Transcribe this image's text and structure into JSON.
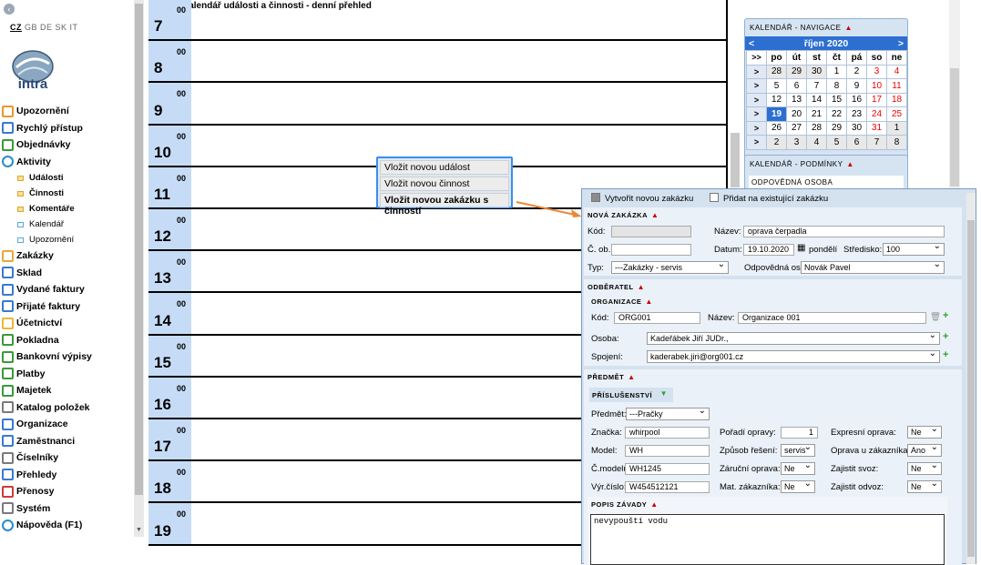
{
  "languages": {
    "active": "CZ",
    "others": "GB DE SK IT"
  },
  "logo_text": "intra",
  "nav": [
    {
      "label": "Upozornění",
      "icon": "bell-icon"
    },
    {
      "label": "Rychlý přístup",
      "icon": "grid-icon"
    },
    {
      "label": "Objednávky",
      "icon": "cart-icon"
    },
    {
      "label": "Aktivity",
      "icon": "refresh-icon"
    },
    {
      "label": "Události",
      "icon": "folder-icon",
      "sub": true
    },
    {
      "label": "Činnosti",
      "icon": "folder-icon",
      "sub": true
    },
    {
      "label": "Komentáře",
      "icon": "folder-icon",
      "sub": true
    },
    {
      "label": "Kalendář",
      "icon": "page-icon",
      "sub": true,
      "light": true
    },
    {
      "label": "Upozornění",
      "icon": "page-icon",
      "sub": true,
      "light": true
    },
    {
      "label": "Zakázky",
      "icon": "clipboard-icon"
    },
    {
      "label": "Sklad",
      "icon": "warehouse-icon"
    },
    {
      "label": "Vydané faktury",
      "icon": "invoice-out-icon"
    },
    {
      "label": "Přijaté faktury",
      "icon": "invoice-in-icon"
    },
    {
      "label": "Účetnictví",
      "icon": "ledger-icon"
    },
    {
      "label": "Pokladna",
      "icon": "cashbox-icon"
    },
    {
      "label": "Bankovní výpisy",
      "icon": "bank-icon"
    },
    {
      "label": "Platby",
      "icon": "coins-icon"
    },
    {
      "label": "Majetek",
      "icon": "building-icon"
    },
    {
      "label": "Katalog položek",
      "icon": "catalog-icon"
    },
    {
      "label": "Organizace",
      "icon": "organization-icon"
    },
    {
      "label": "Zaměstnanci",
      "icon": "employees-icon"
    },
    {
      "label": "Číselníky",
      "icon": "gear-icon"
    },
    {
      "label": "Přehledy",
      "icon": "list-icon"
    },
    {
      "label": "Přenosy",
      "icon": "transfer-icon"
    },
    {
      "label": "Systém",
      "icon": "wrench-icon"
    },
    {
      "label": "Nápověda (F1)",
      "icon": "help-icon"
    }
  ],
  "calendar_title": "Kalendář události a činnosti - denní přehled",
  "hours": [
    "7",
    "8",
    "9",
    "10",
    "11",
    "12",
    "13",
    "14",
    "15",
    "16",
    "17",
    "18",
    "19"
  ],
  "minutes": "00",
  "context_menu": [
    "Vložit novou událost",
    "Vložit novou činnost",
    "Vložit novou zakázku s činností"
  ],
  "calnav": {
    "title": "KALENDÁŘ - NAVIGACE",
    "prev": "<",
    "next": ">",
    "month": "říjen 2020",
    "week_jump": ">>",
    "weekdays": [
      "po",
      "út",
      "st",
      "čt",
      "pá",
      "so",
      "ne"
    ],
    "row_arrow": ">",
    "weeks": [
      [
        "28",
        "29",
        "30",
        "1",
        "2",
        "3",
        "4"
      ],
      [
        "5",
        "6",
        "7",
        "8",
        "9",
        "10",
        "11"
      ],
      [
        "12",
        "13",
        "14",
        "15",
        "16",
        "17",
        "18"
      ],
      [
        "19",
        "20",
        "21",
        "22",
        "23",
        "24",
        "25"
      ],
      [
        "26",
        "27",
        "28",
        "29",
        "30",
        "31",
        "1"
      ],
      [
        "2",
        "3",
        "4",
        "5",
        "6",
        "7",
        "8"
      ]
    ],
    "today": "19"
  },
  "conditions": {
    "title": "KALENDÁŘ - PODMÍNKY",
    "responsible": "ODPOVĚDNÁ OSOBA"
  },
  "form": {
    "create_new": "Vytvořit novou zakázku",
    "add_existing": "Přidat na existující zakázku",
    "section_new": "NOVÁ ZAKÁZKA",
    "kod_label": "Kód:",
    "kod_value": "",
    "nazev_label": "Název:",
    "nazev_value": "oprava čerpadla",
    "cob_label": "Č. ob.:",
    "cob_value": "",
    "datum_label": "Datum:",
    "datum_value": "19.10.2020",
    "day_name": "pondělí",
    "stredisko_label": "Středisko:",
    "stredisko_value": "100",
    "typ_label": "Typ:",
    "typ_value": "---Zakázky - servis",
    "odpovedna_label": "Odpovědná os.:",
    "odpovedna_value": "Novák Pavel",
    "section_odb": "ODBĚRATEL",
    "section_org": "ORGANIZACE",
    "org_kod_label": "Kód:",
    "org_kod_value": "ORG001",
    "org_nazev_label": "Název:",
    "org_nazev_value": "Organizace 001",
    "osoba_label": "Osoba:",
    "osoba_value": "Kadeřábek Jiří JUDr.,",
    "spojeni_label": "Spojení:",
    "spojeni_value": "kaderabek.jiri@org001.cz",
    "section_predmet": "PŘEDMĚT",
    "prislusenstvi": "PŘÍSLUŠENSTVÍ",
    "predmet_label": "Předmět:",
    "predmet_value": "---Pračky",
    "znacka_label": "Značka:",
    "znacka_value": "whirpool",
    "poradi_label": "Pořadí opravy:",
    "poradi_value": "1",
    "expresni_label": "Expresní oprava:",
    "expresni_value": "Ne",
    "model_label": "Model:",
    "model_value": "WH",
    "zpusob_label": "Způsob řešení:",
    "zpusob_value": "servis",
    "oprava_zak_label": "Oprava u zákazníka:",
    "oprava_zak_value": "Ano",
    "cmodelu_label": "Č.modelu:",
    "cmodelu_value": "WH1245",
    "zarucni_label": "Záruční oprava:",
    "zarucni_value": "Ne",
    "svoz_label": "Zajistit svoz:",
    "svoz_value": "Ne",
    "vyrcislo_label": "Výr.číslo:",
    "vyrcislo_value": "W454512121",
    "mat_label": "Mat. zákazníka:",
    "mat_value": "Ne",
    "odvoz_label": "Zajistit odvoz:",
    "odvoz_value": "Ne",
    "section_popis": "POPIS ZÁVADY",
    "popis_value": "nevypouští vodu"
  }
}
